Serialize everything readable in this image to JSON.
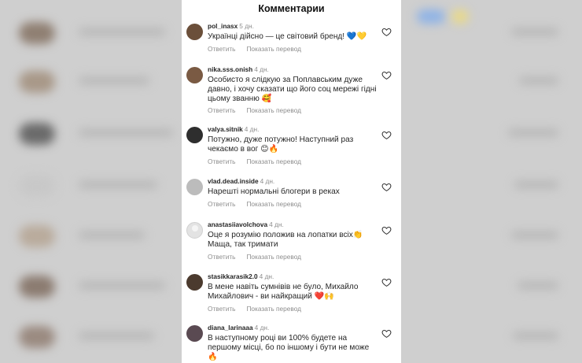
{
  "header": {
    "title": "Комментарии"
  },
  "actions": {
    "reply": "Ответить",
    "translate": "Показать перевод"
  },
  "colors": {
    "panel_bg": "#ffffff",
    "muted_text": "#8e8e8e",
    "primary_text": "#262626",
    "heart_emoji": "#ff3040"
  },
  "comments": [
    {
      "username": "pol_inasx",
      "time": "5 дн.",
      "text": "Українці дійсно — це світовий бренд! 💙💛",
      "avatar_color": "#6b4f3a"
    },
    {
      "username": "nika.sss.onish",
      "time": "4 дн.",
      "text": "Особисто я слідкую за Поплавським дуже давно, і хочу сказати що його соц мережі гідні цьому званню 🥰",
      "avatar_color": "#7a5a43"
    },
    {
      "username": "valya.sitnik",
      "time": "4 дн.",
      "text": "Потужно, дуже потужно! Наступний раз чекаємо в вог 😊🔥",
      "avatar_color": "#2e2e2e"
    },
    {
      "username": "vlad.dead.inside",
      "time": "4 дн.",
      "text": "Нарешті нормальні блогери в реках",
      "avatar_color": "#bcbcbc"
    },
    {
      "username": "anastasiiavolchova",
      "time": "4 дн.",
      "text": "Оце я розумію положив на лопатки всіх👏 Маща, так тримати",
      "avatar_color": "blank"
    },
    {
      "username": "stasikkarasik2.0",
      "time": "4 дн.",
      "text": "В мене навіть сумнівів не було, Михайло Михайлович - ви найкращий ❤️🙌",
      "avatar_color": "#4b3a2e"
    },
    {
      "username": "diana_larinaaa",
      "time": "4 дн.",
      "text": "В наступному році ви 100% будете на першому місці, бо по іншому і бути не може 🔥",
      "avatar_color": "#5a4a52"
    }
  ]
}
